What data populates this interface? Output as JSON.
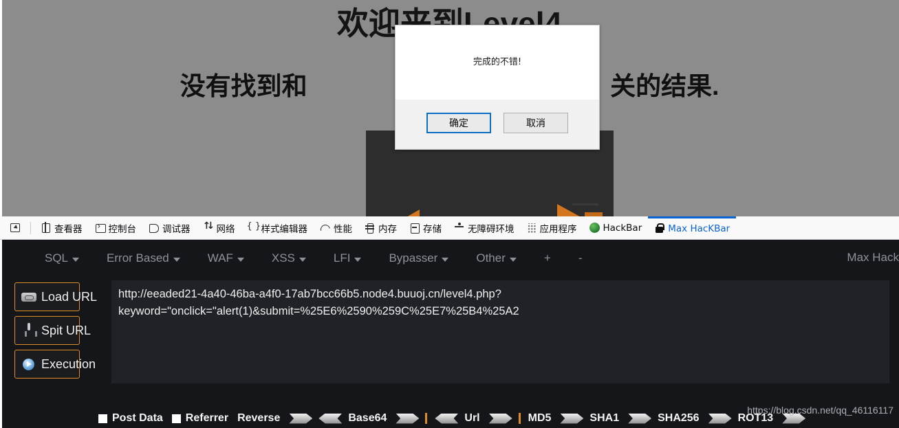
{
  "page": {
    "title": "欢迎来到Level4",
    "subtitle": "没有找到和\"onclick=\"alert(1)相关的结果.",
    "subtitle_left": "没有找到和",
    "subtitle_right": "关的结果.",
    "background_color": "#8c8c8c"
  },
  "dialog": {
    "message": "完成的不错!",
    "confirm_label": "确定",
    "cancel_label": "取消",
    "accent_color": "#0a6fc2"
  },
  "devtools": {
    "tools": [
      {
        "label": "",
        "icon": "element-picker-icon",
        "active": false
      },
      {
        "label": "查看器",
        "icon": "inspector-icon",
        "active": false
      },
      {
        "label": "控制台",
        "icon": "console-icon",
        "active": false
      },
      {
        "label": "调试器",
        "icon": "debugger-icon",
        "active": false
      },
      {
        "label": "网络",
        "icon": "network-icon",
        "active": false
      },
      {
        "label": "样式编辑器",
        "icon": "style-editor-icon",
        "active": false
      },
      {
        "label": "性能",
        "icon": "performance-icon",
        "active": false
      },
      {
        "label": "内存",
        "icon": "memory-icon",
        "active": false
      },
      {
        "label": "存储",
        "icon": "storage-icon",
        "active": false
      },
      {
        "label": "无障碍环境",
        "icon": "accessibility-icon",
        "active": false
      },
      {
        "label": "应用程序",
        "icon": "application-icon",
        "active": false
      },
      {
        "label": "HackBar",
        "icon": "hackbar-icon",
        "active": false
      },
      {
        "label": "Max HacKBar",
        "icon": "lock-icon",
        "active": true
      }
    ],
    "active_tab_color": "#0a62d6"
  },
  "hackbar": {
    "menus": [
      {
        "label": "SQL",
        "caret": true
      },
      {
        "label": "Error Based",
        "caret": true
      },
      {
        "label": "WAF",
        "caret": true
      },
      {
        "label": "XSS",
        "caret": true
      },
      {
        "label": "LFI",
        "caret": true
      },
      {
        "label": "Bypasser",
        "caret": true
      },
      {
        "label": "Other",
        "caret": true
      },
      {
        "label": "+",
        "caret": false
      },
      {
        "label": "-",
        "caret": false
      }
    ],
    "brand": "Max Hack",
    "actions": [
      {
        "label": "Load URL",
        "icon": "load-url-icon"
      },
      {
        "label": "Spit URL",
        "icon": "spit-url-icon"
      },
      {
        "label": "Execution",
        "icon": "execution-icon"
      }
    ],
    "url_value": "http://eeaded21-4a40-46ba-a4f0-17ab7bcc66b5.node4.buuoj.cn/level4.php?keyword=\"onclick=\"alert(1)&submit=%25E6%2590%259C%25E7%25B4%25A2",
    "url_lines": [
      "http://eeaded21-4a40-46ba-a4f0-17ab7bcc66b5.node4.buuoj.cn/level4.php",
      "?keyword=\"onclick=\"alert(1)",
      "&submit=%25E6%2590%259C%25E7%25B4%25A2"
    ],
    "border_color": "#e08b23",
    "footer": [
      {
        "type": "checkbox",
        "name": "post-data-checkbox"
      },
      {
        "type": "label",
        "label": "Post Data"
      },
      {
        "type": "checkbox",
        "name": "referrer-checkbox"
      },
      {
        "type": "label",
        "label": "Referrer"
      },
      {
        "type": "label",
        "label": "Reverse"
      },
      {
        "type": "arrow-right",
        "name": "reverse-encode-arrow"
      },
      {
        "type": "arrow-left",
        "name": "reverse-decode-arrow"
      },
      {
        "type": "label",
        "label": "Base64"
      },
      {
        "type": "arrow-right",
        "name": "base64-encode-arrow"
      },
      {
        "type": "pipe"
      },
      {
        "type": "arrow-left",
        "name": "url-decode-arrow"
      },
      {
        "type": "label",
        "label": "Url"
      },
      {
        "type": "arrow-right",
        "name": "url-encode-arrow"
      },
      {
        "type": "pipe"
      },
      {
        "type": "label",
        "label": "MD5"
      },
      {
        "type": "arrow-right",
        "name": "md5-hash-arrow"
      },
      {
        "type": "label",
        "label": "SHA1"
      },
      {
        "type": "arrow-right",
        "name": "sha1-hash-arrow"
      },
      {
        "type": "label",
        "label": "SHA256"
      },
      {
        "type": "arrow-right",
        "name": "sha256-hash-arrow"
      },
      {
        "type": "label",
        "label": "ROT13"
      },
      {
        "type": "arrow-right",
        "name": "rot13-arrow"
      }
    ]
  },
  "watermark": "https://blog.csdn.net/qq_46116117"
}
